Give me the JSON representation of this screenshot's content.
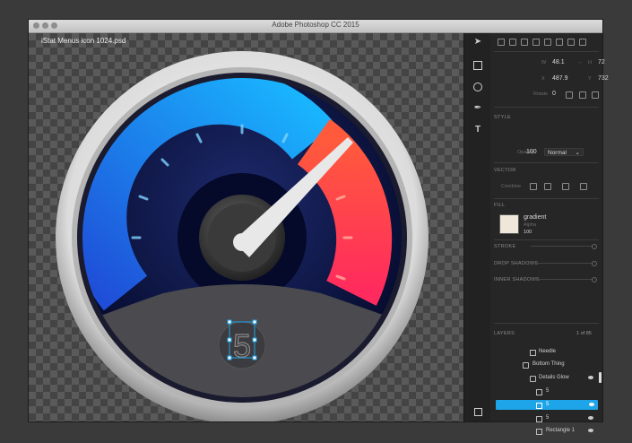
{
  "window": {
    "title": "Adobe Photoshop CC 2015"
  },
  "document": {
    "name": "iStat Menus icon 1024.psd"
  },
  "gauge": {
    "digit": "5"
  },
  "transform": {
    "w_label": "W",
    "w_value": "48.1",
    "h_label": "H",
    "h_value": "72",
    "x_label": "X",
    "x_value": "487.9",
    "y_label": "Y",
    "y_value": "732",
    "rotate_label": "Rotate",
    "rotate_value": "0"
  },
  "style": {
    "section": "STYLE",
    "opacity_label": "Opacity",
    "opacity_value": "100",
    "blend_mode": "Normal"
  },
  "vector": {
    "section": "VECTOR",
    "combine_label": "Combine"
  },
  "fill": {
    "section": "FILL",
    "name": "gradient",
    "sub": "Alpha",
    "value": "100"
  },
  "effects": {
    "stroke": "STROKE",
    "drop_shadows": "DROP SHADOWS",
    "inner_shadows": "INNER SHADOWS"
  },
  "layers": {
    "section": "LAYERS",
    "count": "1 of 85",
    "items": [
      {
        "name": "Needle",
        "type": "shape"
      },
      {
        "name": "Bottom Thing",
        "type": "folder"
      },
      {
        "name": "Details Glow",
        "type": "folder"
      },
      {
        "name": "5",
        "type": "shape"
      },
      {
        "name": "5",
        "type": "shape",
        "selected": true
      },
      {
        "name": "5",
        "type": "shape"
      },
      {
        "name": "Rectangle 1",
        "type": "shape"
      }
    ]
  },
  "colors": {
    "accent": "#1ea4e8",
    "gauge_blue": "#1aa0f0",
    "gauge_red": "#ff3b3b"
  }
}
